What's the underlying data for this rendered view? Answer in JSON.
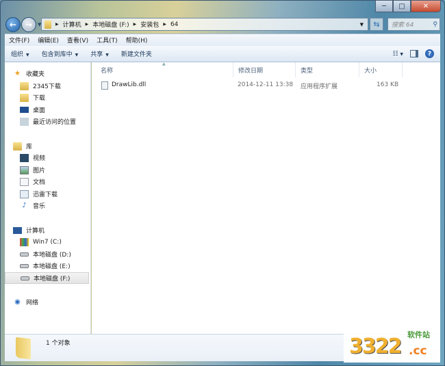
{
  "window": {
    "minimize": "─",
    "maximize": "□",
    "close": "✕"
  },
  "address": {
    "path": [
      "计算机",
      "本地磁盘 (F:)",
      "安装包",
      "64"
    ],
    "search_placeholder": "搜索 64"
  },
  "menu": [
    "文件(F)",
    "编辑(E)",
    "查看(V)",
    "工具(T)",
    "帮助(H)"
  ],
  "toolbar": {
    "organize": "组织",
    "include": "包含到库中",
    "share": "共享",
    "new_folder": "新建文件夹"
  },
  "nav": {
    "favorites": {
      "label": "收藏夹",
      "items": [
        "2345下载",
        "下载",
        "桌面",
        "最近访问的位置"
      ]
    },
    "libraries": {
      "label": "库",
      "items": [
        "视频",
        "图片",
        "文档",
        "迅雷下载",
        "音乐"
      ]
    },
    "computer": {
      "label": "计算机",
      "items": [
        "Win7 (C:)",
        "本地磁盘 (D:)",
        "本地磁盘 (E:)",
        "本地磁盘 (F:)"
      ],
      "selected": "本地磁盘 (F:)"
    },
    "network": {
      "label": "网络"
    }
  },
  "columns": {
    "name": "名称",
    "date": "修改日期",
    "type": "类型",
    "size": "大小"
  },
  "files": [
    {
      "name": "DrawLib.dll",
      "date": "2014-12-11 13:38",
      "type": "应用程序扩展",
      "size": "163 KB"
    }
  ],
  "status": {
    "count": "1 个对象"
  },
  "watermark": {
    "text": "3322.cc",
    "sub": "软件站"
  }
}
